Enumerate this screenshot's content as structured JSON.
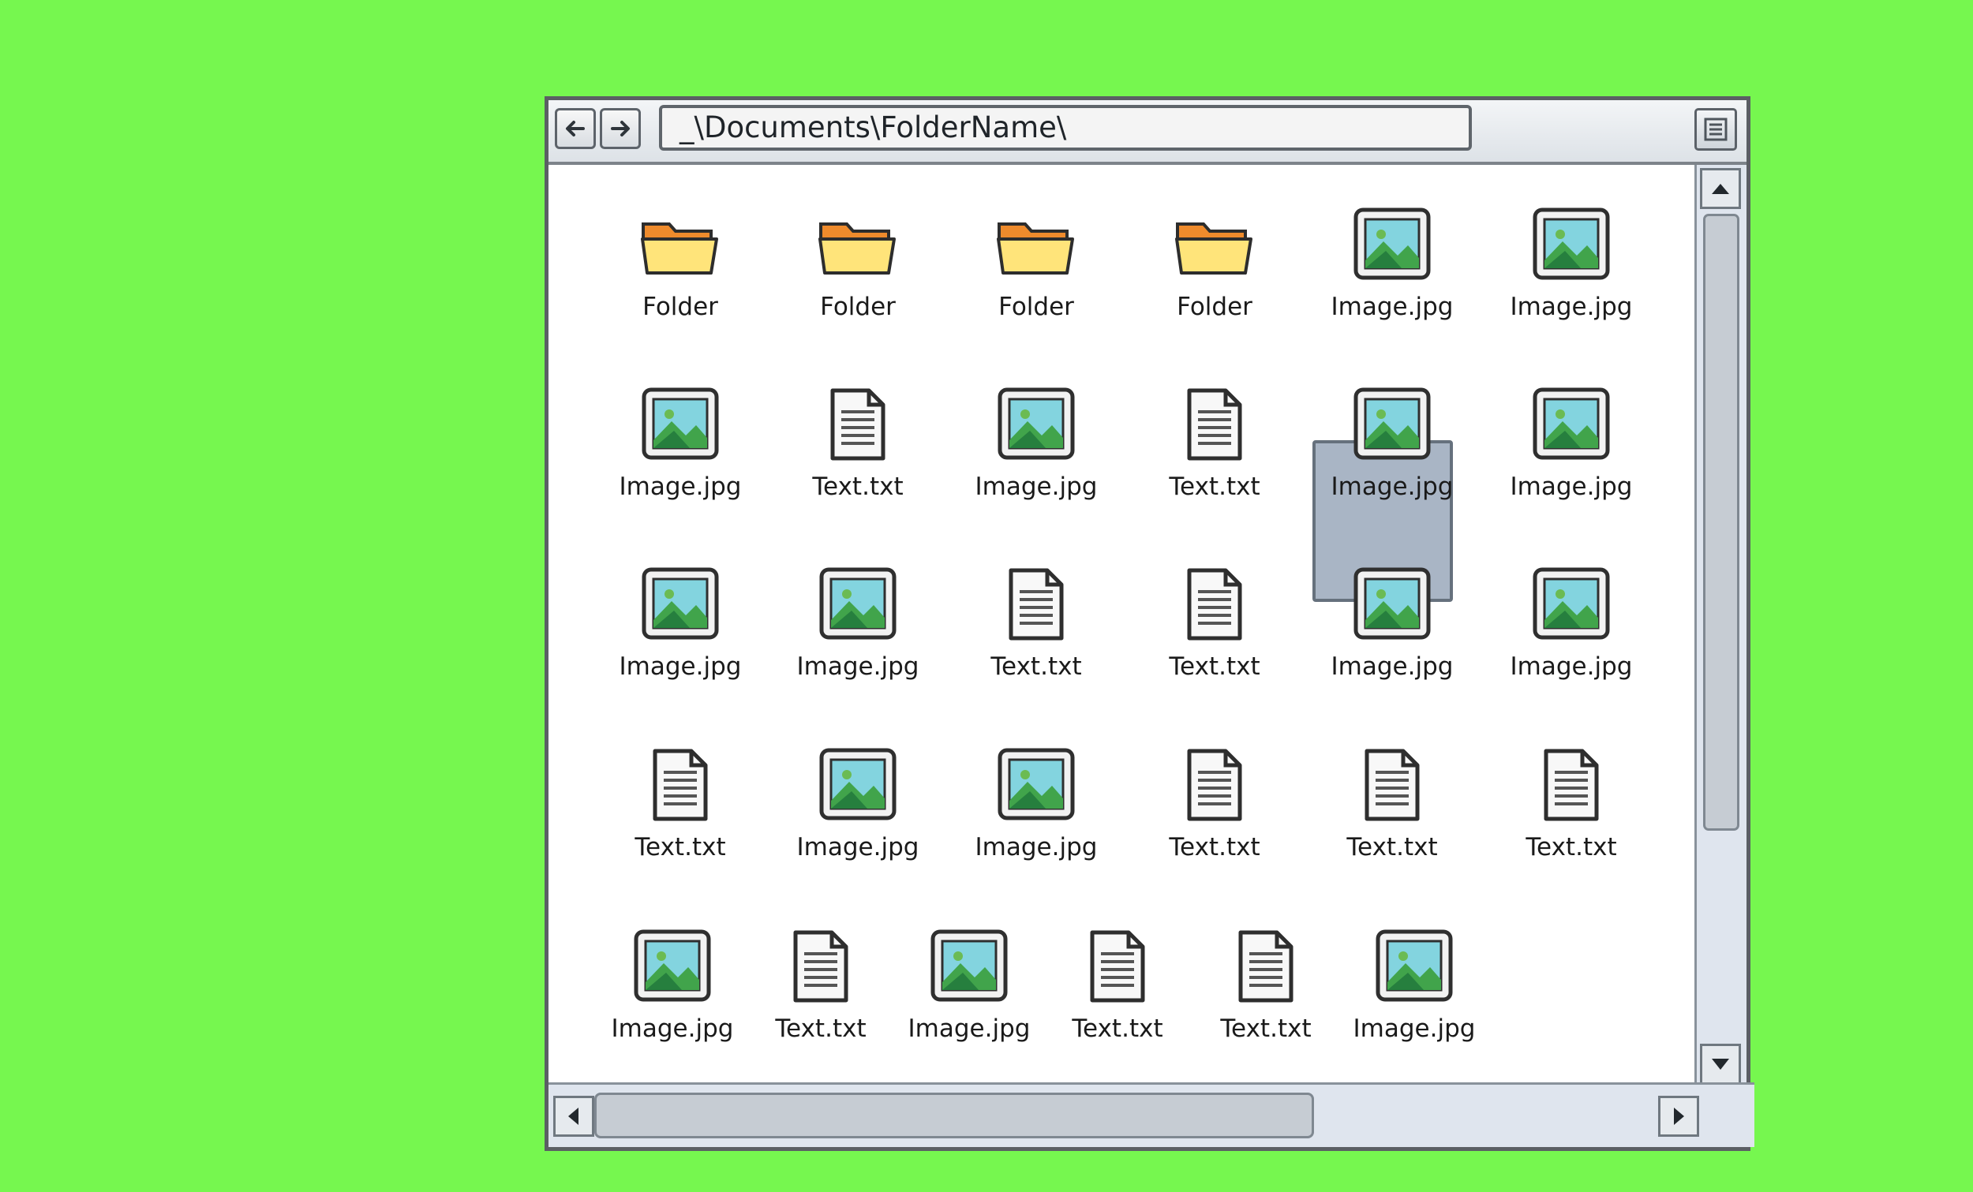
{
  "address_bar": {
    "path": "_\\Documents\\FolderName\\"
  },
  "icons": {
    "back": "left-arrow-icon",
    "forward": "right-arrow-icon",
    "menu": "menu-icon",
    "folder": "folder-icon",
    "image": "image-file-icon",
    "text": "text-file-icon"
  },
  "items": [
    {
      "label": "Folder",
      "type": "folder"
    },
    {
      "label": "Folder",
      "type": "folder"
    },
    {
      "label": "Folder",
      "type": "folder"
    },
    {
      "label": "Folder",
      "type": "folder"
    },
    {
      "label": "Image.jpg",
      "type": "image"
    },
    {
      "label": "Image.jpg",
      "type": "image"
    },
    {
      "label": "Image.jpg",
      "type": "image"
    },
    {
      "label": "Text.txt",
      "type": "text"
    },
    {
      "label": "Image.jpg",
      "type": "image"
    },
    {
      "label": "Text.txt",
      "type": "text"
    },
    {
      "label": "Image.jpg",
      "type": "image",
      "selected": true
    },
    {
      "label": "Image.jpg",
      "type": "image"
    },
    {
      "label": "Image.jpg",
      "type": "image"
    },
    {
      "label": "Image.jpg",
      "type": "image"
    },
    {
      "label": "Text.txt",
      "type": "text"
    },
    {
      "label": "Text.txt",
      "type": "text"
    },
    {
      "label": "Image.jpg",
      "type": "image"
    },
    {
      "label": "Image.jpg",
      "type": "image"
    },
    {
      "label": "Text.txt",
      "type": "text"
    },
    {
      "label": "Image.jpg",
      "type": "image"
    },
    {
      "label": "Image.jpg",
      "type": "image"
    },
    {
      "label": "Text.txt",
      "type": "text"
    },
    {
      "label": "Text.txt",
      "type": "text"
    },
    {
      "label": "Text.txt",
      "type": "text"
    },
    {
      "label": "Image.jpg",
      "type": "image"
    },
    {
      "label": "Text.txt",
      "type": "text"
    },
    {
      "label": "Image.jpg",
      "type": "image"
    },
    {
      "label": "Text.txt",
      "type": "text"
    },
    {
      "label": "Text.txt",
      "type": "text"
    },
    {
      "label": "Image.jpg",
      "type": "image"
    }
  ]
}
